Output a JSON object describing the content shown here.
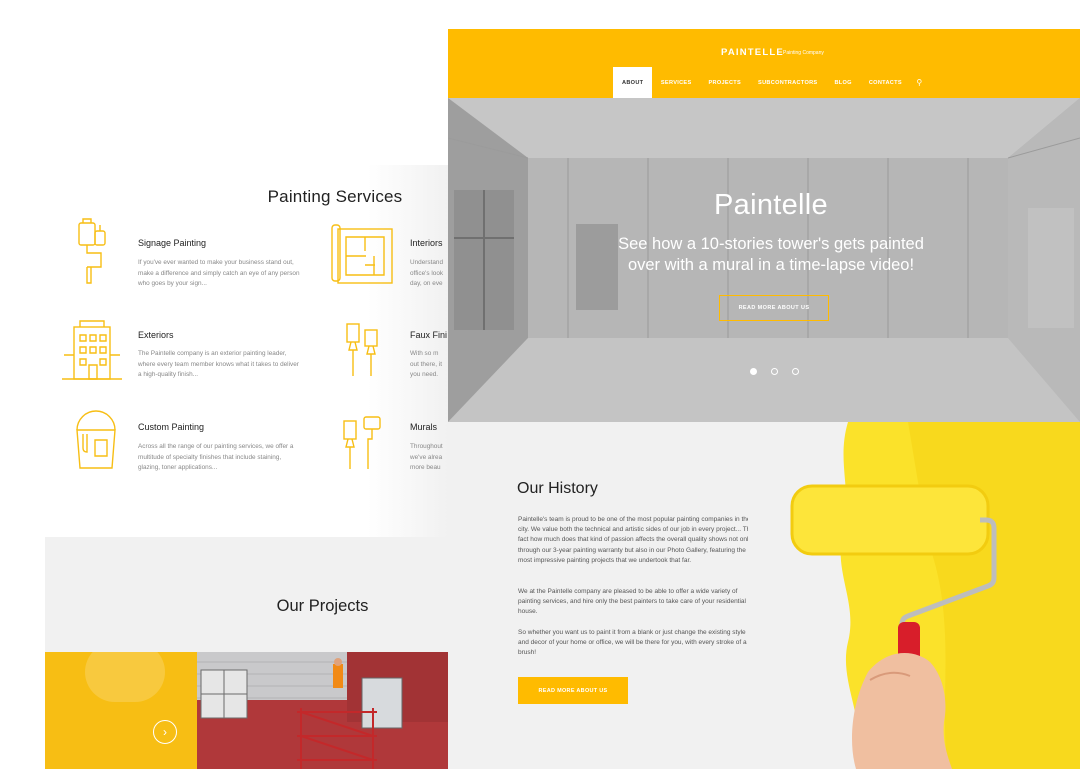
{
  "back": {
    "services_title": "Painting Services",
    "services": [
      {
        "name": "Signage Painting",
        "desc": "If you've ever wanted to make your business stand out, make a difference and simply catch an eye of any person who goes by your sign...",
        "icon": "brush-roller-icon"
      },
      {
        "name": "Interiors",
        "desc": "Understand office's look day, on eve",
        "icon": "blueprint-icon"
      },
      {
        "name": "Exteriors",
        "desc": "The Paintelle company is an exterior painting leader, where every team member knows what it takes to deliver a high-quality finish...",
        "icon": "building-icon"
      },
      {
        "name": "Faux Fini",
        "desc": "With so m out there, it you need.",
        "icon": "paint-brushes-icon"
      },
      {
        "name": "Custom Painting",
        "desc": "Across all the range of our painting services, we offer a multitude of specialty finishes that include staining, glazing, toner applications...",
        "icon": "paint-bucket-icon"
      },
      {
        "name": "Murals",
        "desc": "Throughout we've alrea more beau",
        "icon": "brush-roller-pair-icon"
      }
    ],
    "projects_title": "Our Projects",
    "arrow": "›"
  },
  "header": {
    "logo": "PAINTELLE",
    "logo_sub": "Painting Company",
    "nav": [
      "ABOUT",
      "SERVICES",
      "PROJECTS",
      "SUBCONTRACTORS",
      "BLOG",
      "CONTACTS"
    ],
    "active_nav": "ABOUT",
    "search_icon": "⚲"
  },
  "hero": {
    "title": "Paintelle",
    "subtitle_line1": "See how a 10-stories tower's gets painted",
    "subtitle_line2": "over with a mural in a time-lapse video!",
    "button": "READ MORE ABOUT US",
    "slide_count": 3,
    "active_slide": 1
  },
  "history": {
    "title": "Our History",
    "p1": "Paintelle's team is proud to be one of the most popular painting companies in the city. We value both the technical and artistic sides of our job in every project... The fact how much does that kind of passion affects the overall quality shows not only through our 3-year painting warranty but also in our Photo Gallery, featuring the most impressive painting projects that we undertook that far.",
    "p2": "We at the Paintelle company are pleased to be able to offer a wide variety of painting services, and hire only the best painters to take care of your residential house.",
    "p3": "So whether you want us to paint it from a blank or just change the existing style and decor of your home or office, we will be there for you, with every stroke of a brush!",
    "button": "READ MORE ABOUT US"
  },
  "colors": {
    "accent": "#ffbb00",
    "light_bg": "#f1f1f1"
  }
}
